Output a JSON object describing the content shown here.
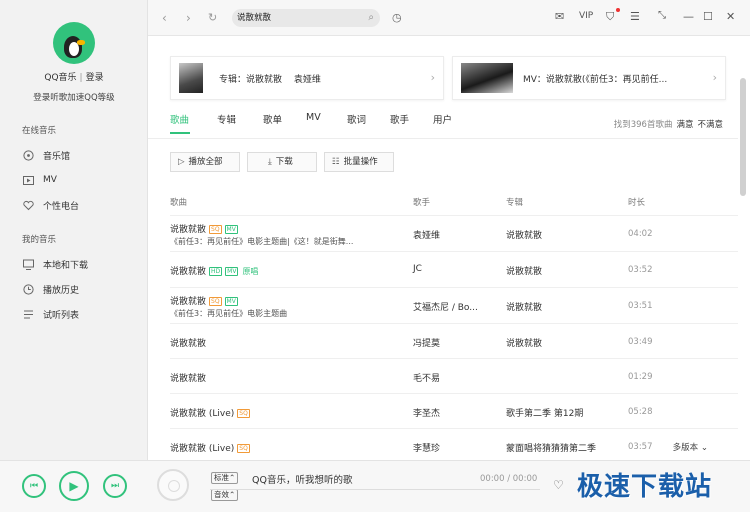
{
  "sidebar": {
    "login_name": "QQ音乐",
    "login_sep": "|",
    "login_label": "登录",
    "login_sub": "登录听歌加速QQ等级",
    "section_online": "在线音乐",
    "section_mine": "我的音乐",
    "items": [
      {
        "label": "音乐馆",
        "icon": "music-hall-icon"
      },
      {
        "label": "MV",
        "icon": "mv-icon"
      },
      {
        "label": "个性电台",
        "icon": "heart-icon"
      },
      {
        "label": "本地和下载",
        "icon": "monitor-icon"
      },
      {
        "label": "播放历史",
        "icon": "clock-icon"
      },
      {
        "label": "试听列表",
        "icon": "list-icon"
      }
    ]
  },
  "topbar": {
    "search_value": "说散就散",
    "vip": "VIP"
  },
  "cards": {
    "album": "专辑：说散就散　 袁娅维",
    "mv": "MV：说散就散(《前任3：再见前任..."
  },
  "tabs": [
    "歌曲",
    "专辑",
    "歌单",
    "MV",
    "歌词",
    "歌手",
    "用户"
  ],
  "found": {
    "count": "找到396首歌曲",
    "satisfied": "满意",
    "unsatisfied": "不满意"
  },
  "actions": {
    "play_all": "播放全部",
    "download": "下载",
    "batch": "批量操作"
  },
  "columns": {
    "song": "歌曲",
    "singer": "歌手",
    "album": "专辑",
    "duration": "时长"
  },
  "rows": [
    {
      "title": "说散就散",
      "badges": [
        "SQ",
        "MV"
      ],
      "subtitle": "《前任3：再见前任》电影主题曲|《这！就是街舞...",
      "singer": "袁娅维",
      "album": "说散就散",
      "duration": "04:02"
    },
    {
      "title": "说散就散",
      "badges": [
        "HD",
        "MV"
      ],
      "extra": "原唱",
      "subtitle": "",
      "singer": "JC",
      "album": "说散就散",
      "duration": "03:52"
    },
    {
      "title": "说散就散",
      "badges": [
        "SQ",
        "MV"
      ],
      "subtitle": "《前任3：再见前任》电影主题曲",
      "singer": "艾福杰尼 / Bo...",
      "album": "说散就散",
      "duration": "03:51"
    },
    {
      "title": "说散就散",
      "badges": [],
      "subtitle": "",
      "singer": "冯提莫",
      "album": "说散就散",
      "duration": "03:49"
    },
    {
      "title": "说散就散",
      "badges": [],
      "subtitle": "",
      "singer": "毛不易",
      "album": "",
      "duration": "01:29"
    },
    {
      "title": "说散就散 (Live)",
      "badges": [
        "SQ"
      ],
      "subtitle": "",
      "singer": "李圣杰",
      "album": "歌手第二季 第12期",
      "duration": "05:28"
    },
    {
      "title": "说散就散 (Live)",
      "badges": [
        "SQ"
      ],
      "subtitle": "",
      "singer": "李慧珍",
      "album": "蒙面唱将猜猜猜第二季",
      "duration": "03:57"
    }
  ],
  "more_versions": "多版本",
  "player": {
    "quality": "标准",
    "effect": "音效",
    "now_playing": "QQ音乐，听我想听的歌",
    "time": "00:00 / 00:00"
  },
  "watermark": "极速下载站",
  "accent": "#31c27c"
}
